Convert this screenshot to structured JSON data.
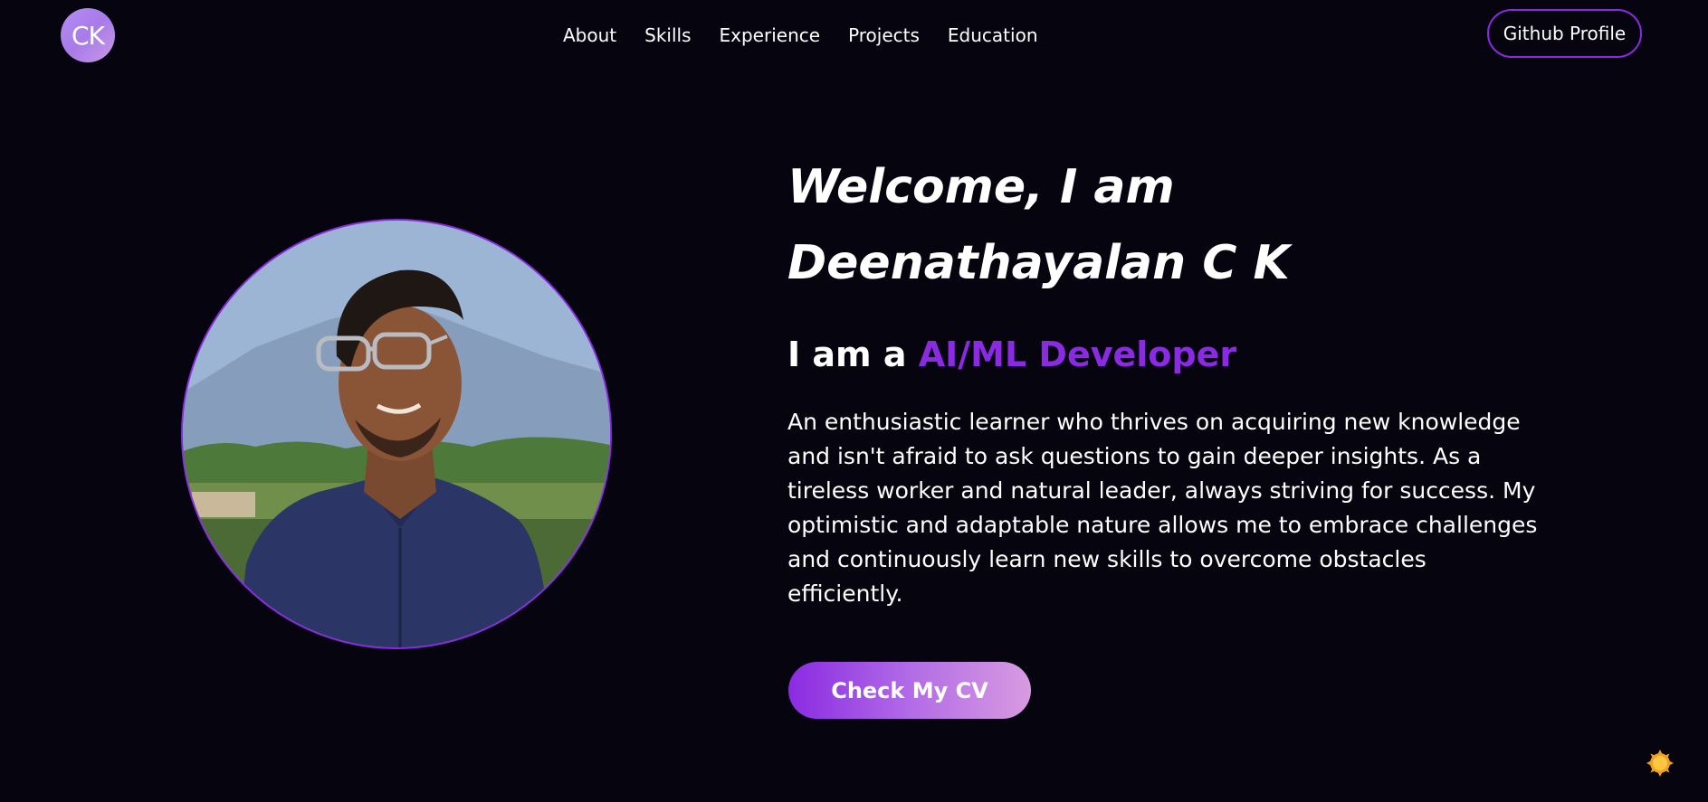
{
  "logo": {
    "text": "CK"
  },
  "nav": {
    "items": [
      {
        "label": "About"
      },
      {
        "label": "Skills"
      },
      {
        "label": "Experience"
      },
      {
        "label": "Projects"
      },
      {
        "label": "Education"
      }
    ],
    "github_label": "Github Profile"
  },
  "hero": {
    "headline_line1": "Welcome, I am",
    "headline_line2": "Deenathayalan C K",
    "role_prefix": "I am a",
    "role_accent": "AI/ML Developer",
    "bio": "An enthusiastic learner who thrives on acquiring new knowledge and isn't afraid to ask questions to gain deeper insights. As a tireless worker and natural leader, always striving for success. My optimistic and adaptable nature allows me to embrace challenges and continuously learn new skills to overcome obstacles efficiently.",
    "cta_label": "Check My CV"
  },
  "colors": {
    "background": "#05040f",
    "accent": "#8a2be2",
    "text": "#ffffff"
  },
  "icons": {
    "theme_toggle": "sun-icon",
    "profile_photo": "profile-photo"
  }
}
